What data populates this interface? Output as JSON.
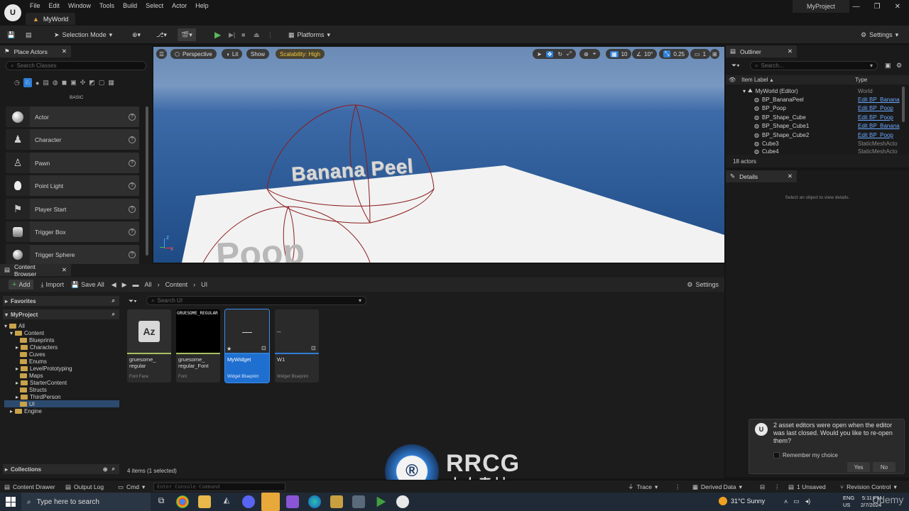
{
  "titlebar": {
    "menu": [
      "File",
      "Edit",
      "Window",
      "Tools",
      "Build",
      "Select",
      "Actor",
      "Help"
    ],
    "world_tab": "MyWorld",
    "project": "MyProject",
    "logo_text": "U"
  },
  "toolbar": {
    "selection_mode": "Selection Mode",
    "platforms": "Platforms",
    "settings": "Settings"
  },
  "place_actors": {
    "tab": "Place Actors",
    "search_placeholder": "Search Classes",
    "category": "BASIC",
    "items": [
      {
        "label": "Actor",
        "icon": "sphere-icon"
      },
      {
        "label": "Character",
        "icon": "character-icon"
      },
      {
        "label": "Pawn",
        "icon": "pawn-icon"
      },
      {
        "label": "Point Light",
        "icon": "light-bulb-icon"
      },
      {
        "label": "Player Start",
        "icon": "flag-icon"
      },
      {
        "label": "Trigger Box",
        "icon": "cylinder-icon"
      },
      {
        "label": "Trigger Sphere",
        "icon": "sphere-icon"
      }
    ]
  },
  "viewport": {
    "perspective": "Perspective",
    "lit": "Lit",
    "show": "Show",
    "scalability": "Scalability: High",
    "grid_snap": "10",
    "rot_snap": "10°",
    "scale_snap": "0.25",
    "camera_speed": "1",
    "world_text_1": "Banana Peel",
    "world_text_2": "Poop",
    "axis_z": "z",
    "axis_x": "x",
    "colors": {
      "sky": "#6a8bb5",
      "floor": "#f2f2f2",
      "wire": "#8b1c1c"
    }
  },
  "outliner": {
    "tab": "Outliner",
    "search_placeholder": "Search...",
    "col_label": "Item Label",
    "col_type": "Type",
    "root": {
      "label": "MyWorld (Editor)",
      "type": "World"
    },
    "rows": [
      {
        "label": "BP_BananaPeel",
        "type": "Edit BP_Banana",
        "link": true
      },
      {
        "label": "BP_Poop",
        "type": "Edit BP_Poop",
        "link": true
      },
      {
        "label": "BP_Shape_Cube",
        "type": "Edit BP_Poop",
        "link": true
      },
      {
        "label": "BP_Shape_Cube1",
        "type": "Edit BP_Banana",
        "link": true
      },
      {
        "label": "BP_Shape_Cube2",
        "type": "Edit BP_Poop",
        "link": true
      },
      {
        "label": "Cube3",
        "type": "StaticMeshActo",
        "link": false
      },
      {
        "label": "Cube4",
        "type": "StaticMeshActo",
        "link": false
      }
    ],
    "count": "18 actors"
  },
  "details": {
    "tab": "Details",
    "empty": "Select an object to view details."
  },
  "content_browser": {
    "tab": "Content Browser",
    "add": "Add",
    "import": "Import",
    "save_all": "Save All",
    "path": [
      "All",
      "Content",
      "UI"
    ],
    "settings": "Settings",
    "favorites": "Favorites",
    "project": "MyProject",
    "search_placeholder": "Search UI",
    "tree": [
      {
        "label": "All",
        "level": 0,
        "arrow": "▾"
      },
      {
        "label": "Content",
        "level": 1,
        "arrow": "▾"
      },
      {
        "label": "Blueprints",
        "level": 2,
        "arrow": ""
      },
      {
        "label": "Characters",
        "level": 2,
        "arrow": "▸"
      },
      {
        "label": "Cuves",
        "level": 2,
        "arrow": ""
      },
      {
        "label": "Enums",
        "level": 2,
        "arrow": ""
      },
      {
        "label": "LevelPrototyping",
        "level": 2,
        "arrow": "▸"
      },
      {
        "label": "Maps",
        "level": 2,
        "arrow": ""
      },
      {
        "label": "StarterContent",
        "level": 2,
        "arrow": "▸"
      },
      {
        "label": "Structs",
        "level": 2,
        "arrow": ""
      },
      {
        "label": "ThirdPerson",
        "level": 2,
        "arrow": "▸"
      },
      {
        "label": "UI",
        "level": 2,
        "arrow": "",
        "selected": true
      },
      {
        "label": "Engine",
        "level": 1,
        "arrow": "▸"
      }
    ],
    "assets": [
      {
        "name": "gruesome_\nregular",
        "type": "Font Face",
        "thumb": "Az",
        "bar": "#a8c060"
      },
      {
        "name": "gruesome_\nregular_Font",
        "type": "Font",
        "thumb": "GRUESOME_REGULAR",
        "bar": "#a8c060"
      },
      {
        "name": "MyWidget",
        "type": "Widget Blueprint",
        "thumb": "—",
        "bar": "#2f7fd6",
        "selected": true
      },
      {
        "name": "W1",
        "type": "Widget Blueprint",
        "thumb": "_",
        "bar": "#2f7fd6"
      }
    ],
    "collections": "Collections",
    "item_count": "4 items (1 selected)"
  },
  "notification": {
    "text": "2 asset editors were open when the editor was last closed. Would you like to re-open them?",
    "checkbox": "Remember my choice",
    "yes": "Yes",
    "no": "No"
  },
  "statusbar": {
    "content_drawer": "Content Drawer",
    "output_log": "Output Log",
    "cmd": "Cmd",
    "console_placeholder": "Enter Console Command",
    "trace": "Trace",
    "derived_data": "Derived Data",
    "unsaved": "1 Unsaved",
    "revision": "Revision Control"
  },
  "taskbar": {
    "search_placeholder": "Type here to search",
    "weather": "31°C  Sunny",
    "lang": "ENG",
    "region": "US",
    "time": "5:11 PM",
    "date": "2/7/2024"
  },
  "watermark": {
    "brand": "RRCG",
    "sub": "人人素材",
    "site": "Udemy"
  }
}
